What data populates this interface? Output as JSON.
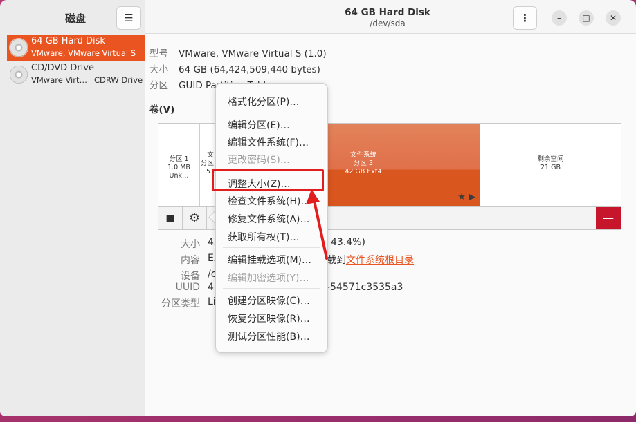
{
  "sidebar": {
    "title": "磁盘",
    "menu_icon": "hamburger-icon",
    "drives": [
      {
        "name": "64 GB Hard Disk",
        "subtitle": "VMware, VMware Virtual S",
        "subtitle_right": "",
        "selected": true
      },
      {
        "name": "CD/DVD Drive",
        "subtitle": "VMware Virt…",
        "subtitle_right": "CDRW Drive",
        "selected": false
      }
    ]
  },
  "header": {
    "title": "64 GB Hard Disk",
    "path": "/dev/sda",
    "kebab": "⋮",
    "min": "–",
    "max": "□",
    "close": "✕"
  },
  "disk_info": {
    "model_key": "型号",
    "model_val": "VMware, VMware Virtual S (1.0)",
    "size_key": "大小",
    "size_val": "64 GB (64,424,509,440 bytes)",
    "part_key": "分区",
    "part_val": "GUID Partition Table"
  },
  "volumes": {
    "label": "卷(V)",
    "segments": [
      {
        "name": "分区 1",
        "detail": "1.0 MB Unk…"
      },
      {
        "name": "文",
        "detail": "分区 2",
        "extra": "53"
      },
      {
        "name": "文件系统",
        "detail": "分区 3",
        "extra": "42 GB Ext4"
      },
      {
        "name": "剩余空间",
        "detail": "21 GB"
      }
    ],
    "selected_icons": "★ ▶",
    "stop_icon": "■",
    "gear_icon": "⚙",
    "delete_icon": "—"
  },
  "details": {
    "size_key": "大小",
    "size_val": "42",
    "size_tail": "43.4%)",
    "content_key": "内容",
    "content_val": "Ex",
    "content_tail": "载到",
    "content_link": "文件系统根目录",
    "device_key": "设备",
    "device_val": "/c",
    "uuid_key": "UUID",
    "uuid_val": "4b",
    "uuid_tail": "-54571c3535a3",
    "type_key": "分区类型",
    "type_val": "Li"
  },
  "menu": {
    "items": [
      {
        "label": "格式化分区(P)…",
        "disabled": false
      },
      {
        "label": "编辑分区(E)…",
        "disabled": false
      },
      {
        "label": "编辑文件系统(F)…",
        "disabled": false
      },
      {
        "label": "更改密码(S)…",
        "disabled": true
      },
      {
        "label": "调整大小(Z)…",
        "disabled": false
      },
      {
        "label": "检查文件系统(H)…",
        "disabled": false
      },
      {
        "label": "修复文件系统(A)…",
        "disabled": false
      },
      {
        "label": "获取所有权(T)…",
        "disabled": false
      },
      {
        "label": "编辑挂载选项(M)…",
        "disabled": false
      },
      {
        "label": "编辑加密选项(Y)…",
        "disabled": true
      },
      {
        "label": "创建分区映像(C)…",
        "disabled": false
      },
      {
        "label": "恢复分区映像(R)…",
        "disabled": false
      },
      {
        "label": "测试分区性能(B)…",
        "disabled": false
      }
    ]
  },
  "colors": {
    "accent": "#e95420",
    "annotation": "#e11d1d",
    "danger": "#c7162b"
  }
}
